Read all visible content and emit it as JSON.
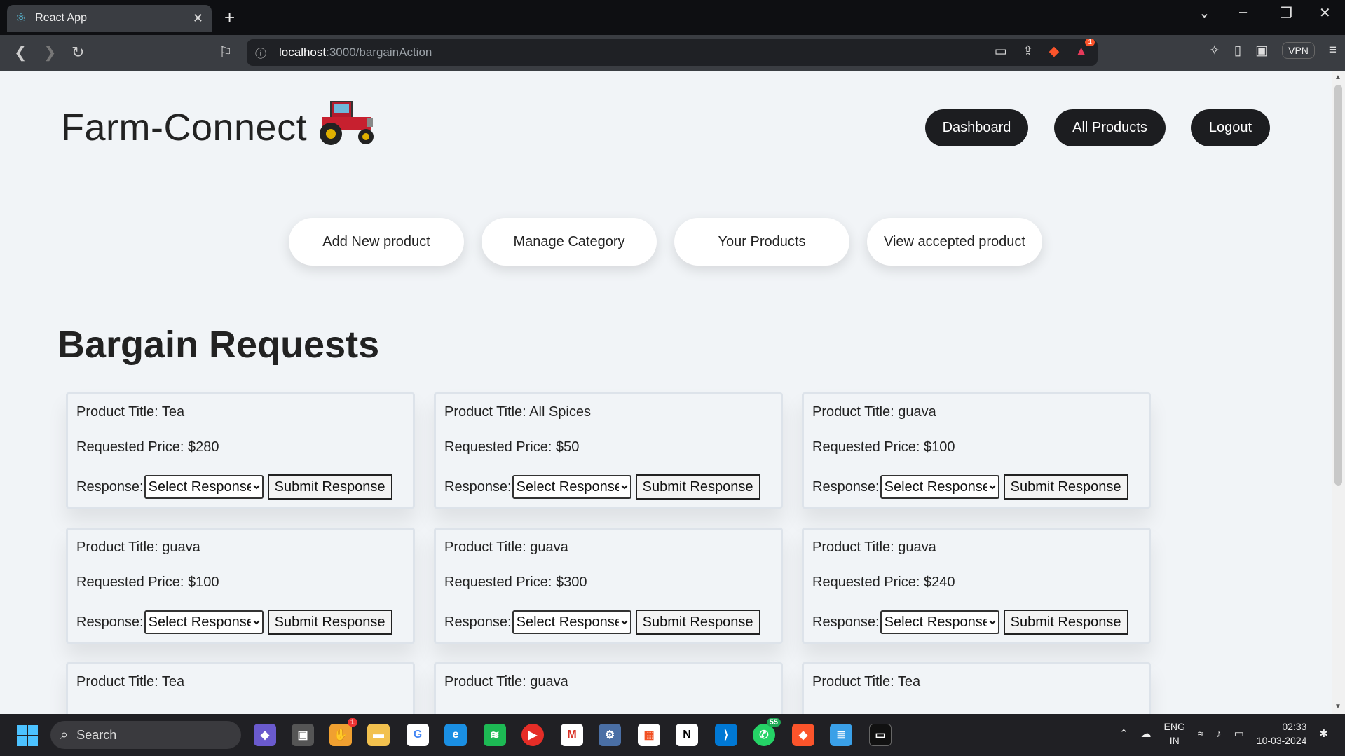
{
  "browser": {
    "tab_title": "React App",
    "url_host": "localhost",
    "url_path": ":3000/bargainAction",
    "vpn_label": "VPN",
    "rewards_badge": "1"
  },
  "header": {
    "brand": "Farm-Connect",
    "nav": [
      {
        "label": "Dashboard"
      },
      {
        "label": "All Products"
      },
      {
        "label": "Logout"
      }
    ]
  },
  "actions": [
    {
      "label": "Add New product"
    },
    {
      "label": "Manage Category"
    },
    {
      "label": "Your Products"
    },
    {
      "label": "View accepted product"
    }
  ],
  "section_title": "Bargain Requests",
  "card_labels": {
    "response": "Response:",
    "select_placeholder": "Select Response",
    "submit": "Submit Response"
  },
  "requests": [
    {
      "title": "Product Title: Tea",
      "price": "Requested Price: $280"
    },
    {
      "title": "Product Title: All Spices",
      "price": "Requested Price: $50"
    },
    {
      "title": "Product Title: guava",
      "price": "Requested Price: $100"
    },
    {
      "title": "Product Title: guava",
      "price": "Requested Price: $100"
    },
    {
      "title": "Product Title: guava",
      "price": "Requested Price: $300"
    },
    {
      "title": "Product Title: guava",
      "price": "Requested Price: $240"
    },
    {
      "title": "Product Title: Tea",
      "price": ""
    },
    {
      "title": "Product Title: guava",
      "price": ""
    },
    {
      "title": "Product Title: Tea",
      "price": ""
    }
  ],
  "taskbar": {
    "search_label": "Search",
    "notification_badge": "1",
    "whatsapp_badge": "55",
    "lang_top": "ENG",
    "lang_bottom": "IN",
    "time": "02:33",
    "date": "10-03-2024"
  },
  "colors": {
    "page_bg": "#f1f4f7",
    "nav_pill": "#1c1d20",
    "accent_brave": "#fb542b"
  }
}
